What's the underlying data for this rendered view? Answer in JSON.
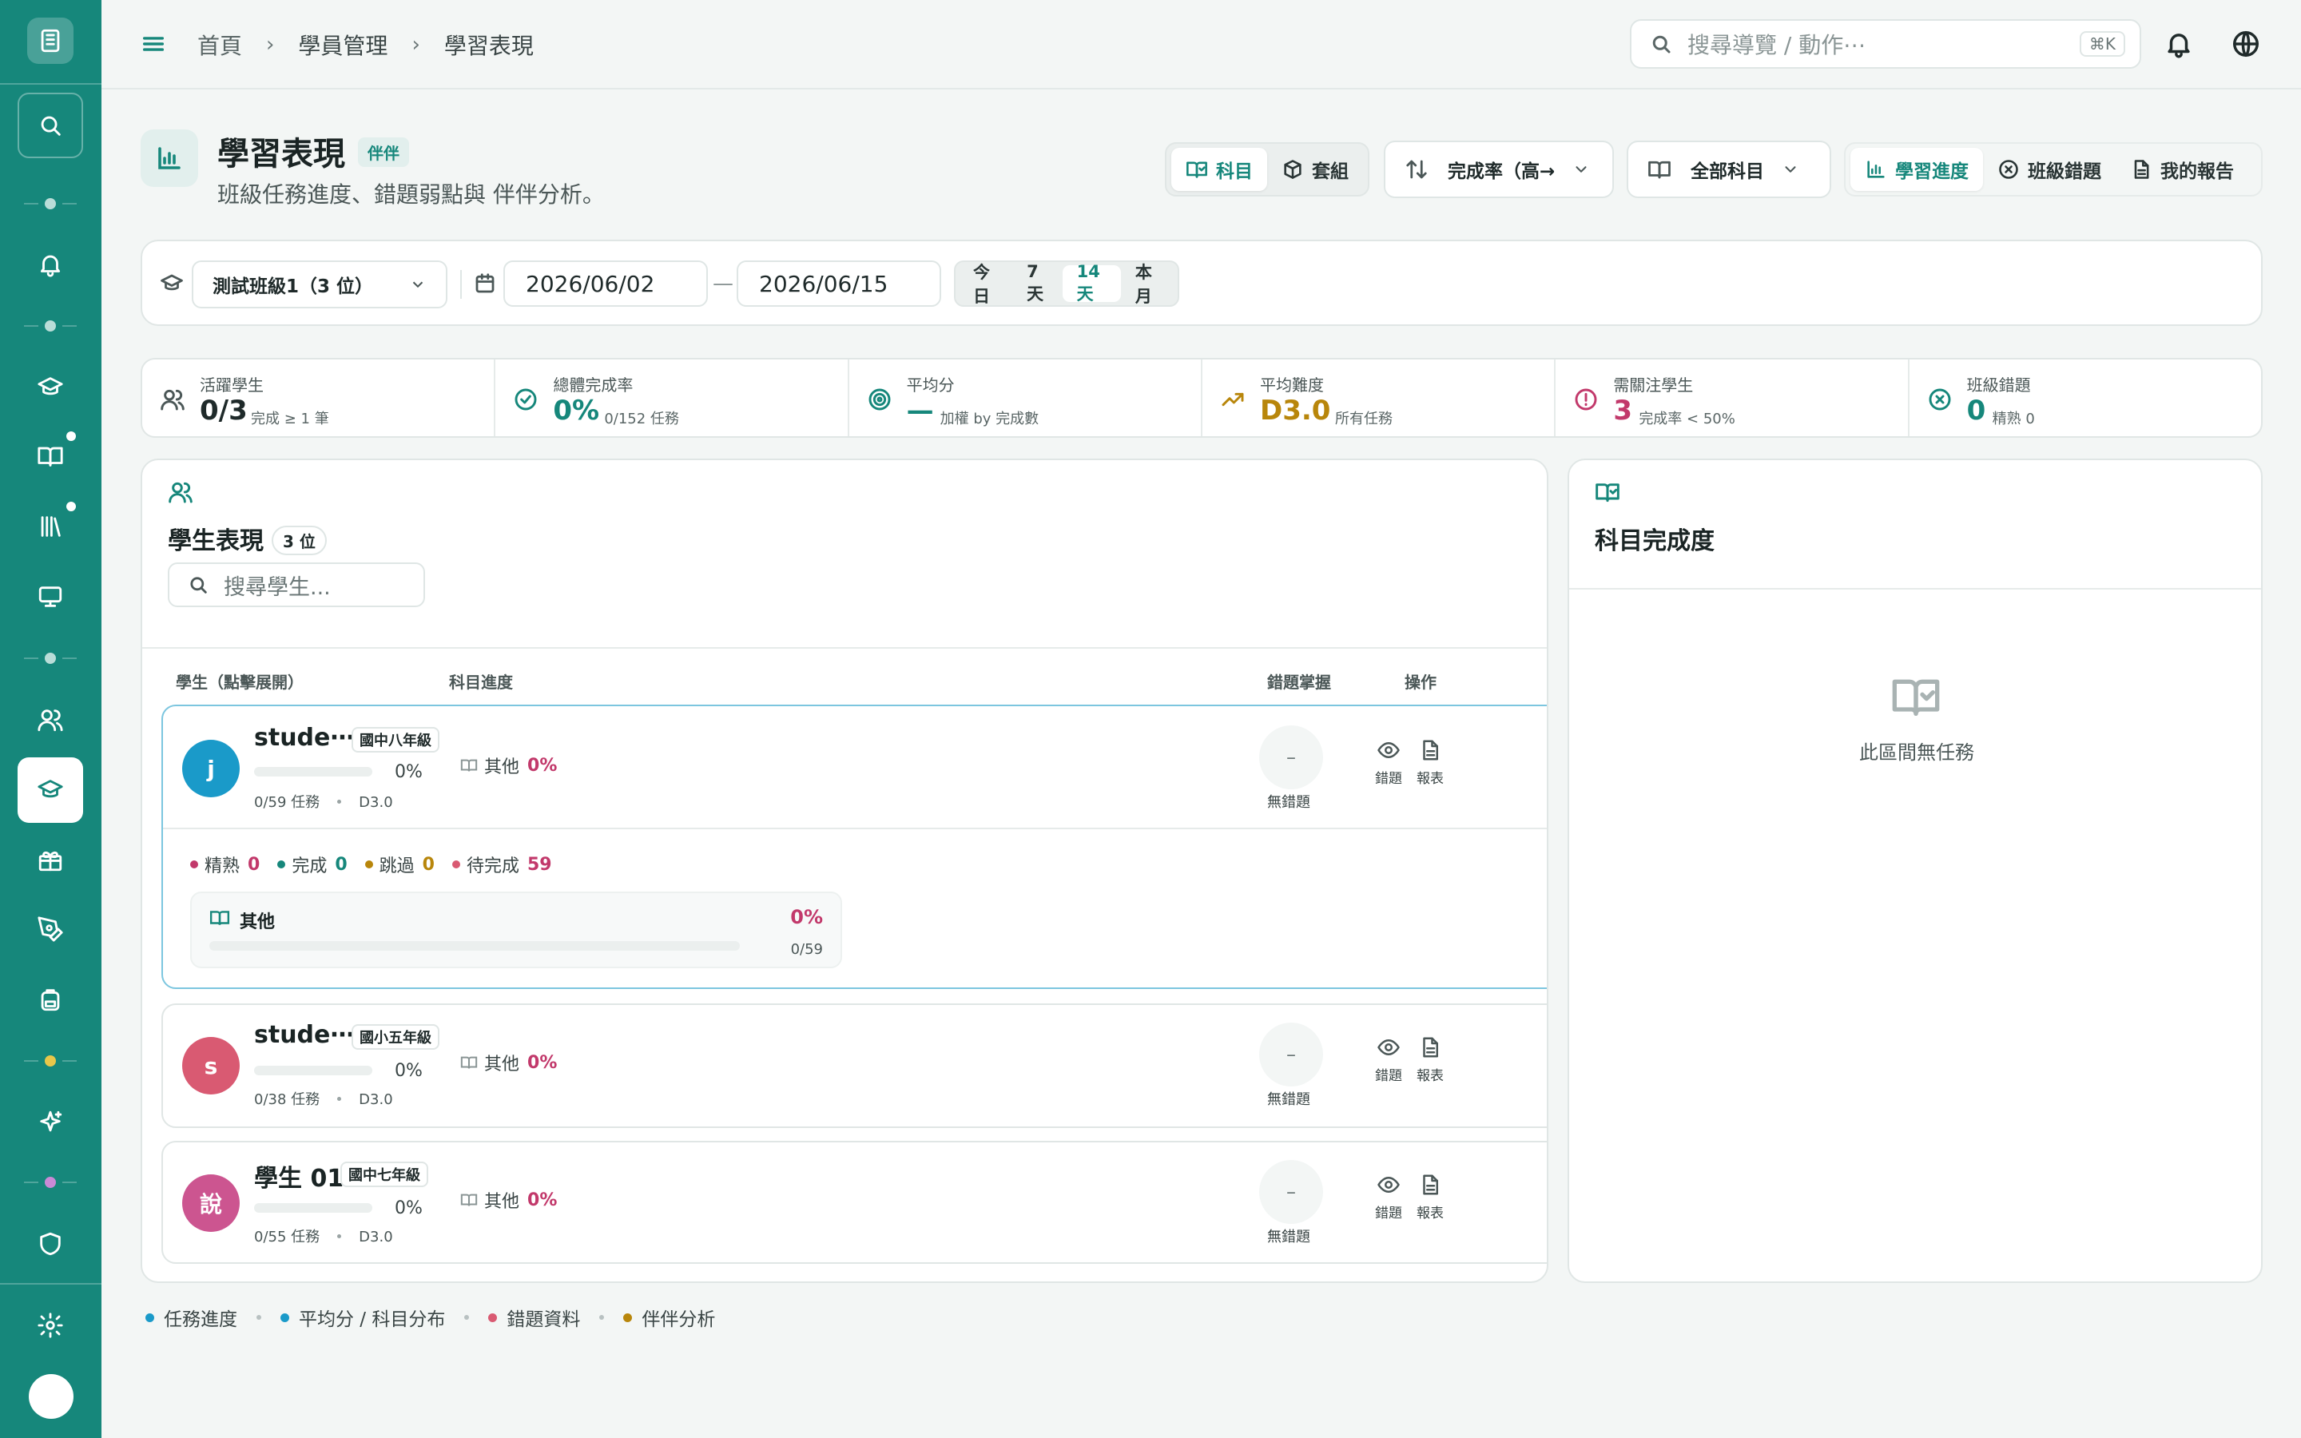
{
  "topbar": {
    "breadcrumb": [
      "首頁",
      "學員管理",
      "學習表現"
    ],
    "search_placeholder": "搜尋導覽 / 動作⋯",
    "shortcut": "⌘K"
  },
  "page": {
    "title": "學習表現",
    "badge": "伴伴",
    "subtitle": "班級任務進度、錯題弱點與 伴伴分析。"
  },
  "toolbar": {
    "view_toggle": [
      {
        "label": "科目",
        "active": true,
        "icon": "book-check-icon"
      },
      {
        "label": "套組",
        "active": false,
        "icon": "package-icon"
      }
    ],
    "sort_label": "完成率（高→",
    "subject_label": "全部科目",
    "report_tabs": [
      {
        "label": "學習進度",
        "active": true
      },
      {
        "label": "班級錯題",
        "active": false
      },
      {
        "label": "我的報告",
        "active": false
      }
    ]
  },
  "filter": {
    "class_select": "測試班級1（3 位）",
    "date_from": "2026/06/02",
    "date_to": "2026/06/15",
    "date_dash": "—",
    "ranges": [
      {
        "label": "今日",
        "active": false
      },
      {
        "label": "7天",
        "active": false
      },
      {
        "label": "14天",
        "active": true
      },
      {
        "label": "本月",
        "active": false
      }
    ]
  },
  "stats": [
    {
      "label": "活躍學生",
      "value": "0/3",
      "note": "完成 ≥ 1 筆",
      "color": "#1f2a2a",
      "icon": "users-icon"
    },
    {
      "label": "總體完成率",
      "value": "0%",
      "note": "0/152 任務",
      "color": "#16877b",
      "icon": "check-circle-icon"
    },
    {
      "label": "平均分",
      "value": "—",
      "note": "加權 by 完成數",
      "color": "#16877b",
      "icon": "target-icon"
    },
    {
      "label": "平均難度",
      "value": "D3.0",
      "note": "所有任務",
      "color": "#b8860b",
      "icon": "trending-up-icon"
    },
    {
      "label": "需關注學生",
      "value": "3",
      "note": "完成率 < 50%",
      "color": "#c2396b",
      "icon": "alert-circle-icon"
    },
    {
      "label": "班級錯題",
      "value": "0",
      "note": "精熟 0",
      "color": "#16877b",
      "icon": "x-circle-icon"
    }
  ],
  "students_panel": {
    "title": "學生表現",
    "count": "3 位",
    "search_placeholder": "搜尋學生...",
    "columns": {
      "student": "學生（點擊展開）",
      "progress": "科目進度",
      "mastery": "錯題掌握",
      "actions": "操作"
    },
    "students": [
      {
        "initial": "j",
        "name": "stude⋯",
        "grade": "國中八年級",
        "pct": "0%",
        "tasks": "0/59 任務",
        "diff": "D3.0",
        "subject": "其他",
        "subject_pct": "0%",
        "mastery": "–",
        "mastery_label": "無錯題",
        "action_view": "錯題",
        "action_report": "報表",
        "avatar_color": "#1a9ac9",
        "expanded": true,
        "detail": {
          "legend": [
            {
              "label": "精熟",
              "value": "0",
              "color": "#c2396b"
            },
            {
              "label": "完成",
              "value": "0",
              "color": "#16877b"
            },
            {
              "label": "跳過",
              "value": "0",
              "color": "#b8860b"
            },
            {
              "label": "待完成",
              "value": "59",
              "color": "#c2396b"
            }
          ],
          "subject_name": "其他",
          "subject_pct": "0%",
          "subject_fraction": "0/59"
        }
      },
      {
        "initial": "s",
        "name": "stude⋯",
        "grade": "國小五年級",
        "pct": "0%",
        "tasks": "0/38 任務",
        "diff": "D3.0",
        "subject": "其他",
        "subject_pct": "0%",
        "mastery": "–",
        "mastery_label": "無錯題",
        "action_view": "錯題",
        "action_report": "報表",
        "avatar_color": "#d95a72",
        "expanded": false
      },
      {
        "initial": "說",
        "name": "學生 01",
        "grade": "國中七年級",
        "pct": "0%",
        "tasks": "0/55 任務",
        "diff": "D3.0",
        "subject": "其他",
        "subject_pct": "0%",
        "mastery": "–",
        "mastery_label": "無錯題",
        "action_view": "錯題",
        "action_report": "報表",
        "avatar_color": "#cc5590",
        "expanded": false
      }
    ]
  },
  "subject_panel": {
    "title": "科目完成度",
    "empty_text": "此區間無任務"
  },
  "footer_legend": [
    {
      "label": "任務進度",
      "color": "#1a9ac9"
    },
    {
      "label": "平均分 / 科目分布",
      "color": "#1a9ac9"
    },
    {
      "label": "錯題資料",
      "color": "#d95a72"
    },
    {
      "label": "伴伴分析",
      "color": "#b8860b"
    }
  ]
}
